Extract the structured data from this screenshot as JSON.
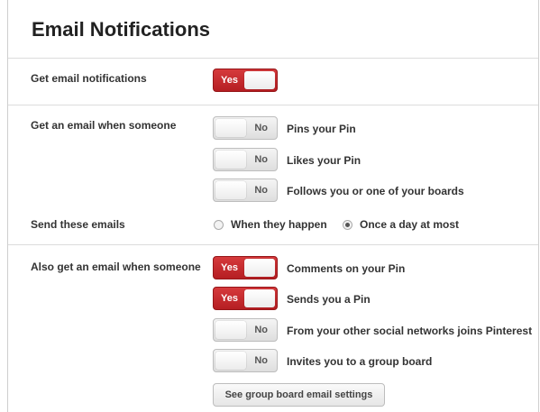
{
  "page_title": "Email Notifications",
  "sections": {
    "get_notifications": {
      "label": "Get email notifications",
      "toggle": "Yes"
    },
    "when_someone": {
      "label": "Get an email when someone",
      "items": [
        {
          "toggle": "No",
          "text": "Pins your Pin"
        },
        {
          "toggle": "No",
          "text": "Likes your Pin"
        },
        {
          "toggle": "No",
          "text": "Follows you or one of your boards"
        }
      ]
    },
    "send_emails": {
      "label": "Send these emails",
      "options": [
        "When they happen",
        "Once a day at most"
      ],
      "selected": "Once a day at most"
    },
    "also_when_someone": {
      "label": "Also get an email when someone",
      "items": [
        {
          "toggle": "Yes",
          "text": "Comments on your Pin"
        },
        {
          "toggle": "Yes",
          "text": "Sends you a Pin"
        },
        {
          "toggle": "No",
          "text": "From your other social networks joins Pinterest"
        },
        {
          "toggle": "No",
          "text": "Invites you to a group board"
        }
      ],
      "button": "See group board email settings"
    }
  },
  "colors": {
    "toggle_on": "#c52a2d",
    "toggle_off": "#e8e8e8"
  }
}
